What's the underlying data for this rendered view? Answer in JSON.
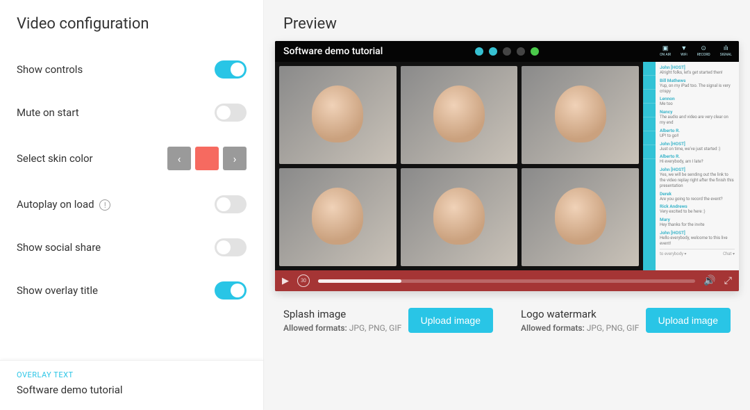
{
  "sidebar": {
    "title": "Video configuration",
    "rows": {
      "show_controls": {
        "label": "Show controls",
        "state": "on"
      },
      "mute_on_start": {
        "label": "Mute on start",
        "state": "off"
      },
      "skin_color": {
        "label": "Select skin color",
        "color": "#f66a60"
      },
      "autoplay": {
        "label": "Autoplay on load",
        "state": "off"
      },
      "social_share": {
        "label": "Show social share",
        "state": "off"
      },
      "overlay_title": {
        "label": "Show overlay title",
        "state": "on"
      }
    },
    "overlay": {
      "label": "OVERLAY TEXT",
      "value": "Software demo tutorial"
    }
  },
  "main": {
    "title": "Preview",
    "preview_title": "Software demo tutorial",
    "stats": [
      {
        "icon": "▣",
        "label": "ON AIR"
      },
      {
        "icon": "▼",
        "label": "WiFi"
      },
      {
        "icon": "⊙",
        "label": "RECORD"
      },
      {
        "icon": "ılı",
        "label": "SIGNAL"
      }
    ],
    "chat": [
      {
        "name": "John [HOST]",
        "text": "Alright folks, let's get started then!"
      },
      {
        "name": "Bill Mathews",
        "text": "Yup, on my iPad too. The signal is very crispy"
      },
      {
        "name": "Lennon",
        "text": "Me too"
      },
      {
        "name": "Nancy",
        "text": "The audio and video are very clear on my end"
      },
      {
        "name": "Alberto R.",
        "text": "UP! to go!!"
      },
      {
        "name": "John [HOST]",
        "text": "Just on time, we've just started :)"
      },
      {
        "name": "Alberto R.",
        "text": "Hi everybody, am I late?"
      },
      {
        "name": "John [HOST]",
        "text": "Yes, we will be sending out the link to the video replay right after the finish this presentation"
      },
      {
        "name": "Derek",
        "text": "Are you going to record the event?"
      },
      {
        "name": "Rick Andrews",
        "text": "Very excited to be here :)"
      },
      {
        "name": "Mary",
        "text": "Hey thanks for the invite"
      },
      {
        "name": "John [HOST]",
        "text": "Hello everybody, welcome to this live event!"
      }
    ],
    "chat_footer": {
      "left": "to everybody",
      "right": "Chat"
    },
    "rewind_label": "30",
    "splash": {
      "title": "Splash image",
      "formats_label": "Allowed formats:",
      "formats": "JPG, PNG, GIF",
      "button": "Upload image"
    },
    "logo": {
      "title": "Logo watermark",
      "formats_label": "Allowed formats:",
      "formats": "JPG, PNG, GIF",
      "button": "Upload image"
    }
  }
}
